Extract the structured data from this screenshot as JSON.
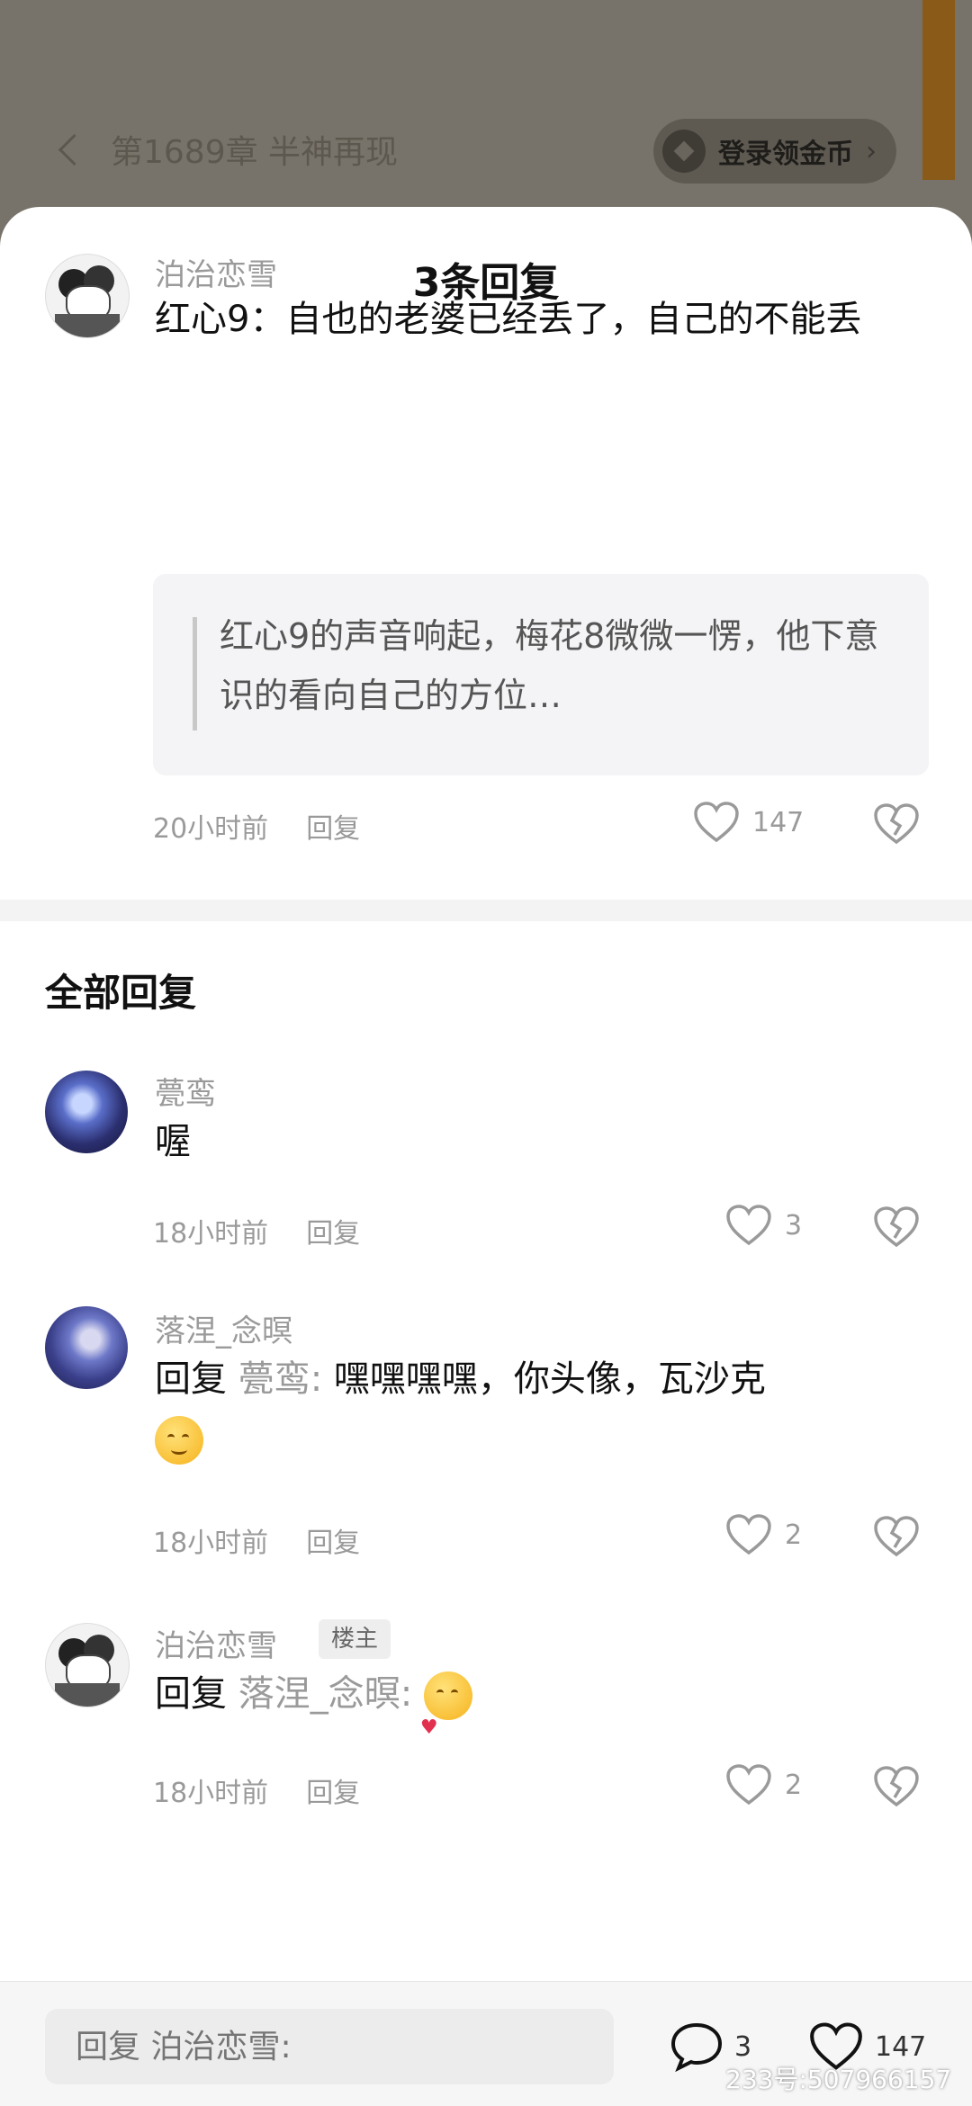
{
  "reader": {
    "chapter_title": "第1689章 半神再现",
    "coin_label": "登录领金币",
    "coin_arrow": "›"
  },
  "sheet": {
    "title": "3条回复"
  },
  "main_comment": {
    "username": "泊治恋雪",
    "text": "红心9：自也的老婆已经丢了，自己的不能丢",
    "quote": "红心9的声音响起，梅花8微微一愣，他下意识的看向自己的方位…",
    "time": "20小时前",
    "reply_label": "回复",
    "likes": "147"
  },
  "section": {
    "all_replies": "全部回复"
  },
  "replies": [
    {
      "username": "甍鸾",
      "text": "喔",
      "time": "18小时前",
      "reply_label": "回复",
      "likes": "3"
    },
    {
      "username": "落涅_念暝",
      "reply_prefix": "回复",
      "reply_to": "甍鸾:",
      "text": "嘿嘿嘿嘿，你头像，瓦沙克",
      "time": "18小时前",
      "reply_label": "回复",
      "likes": "2"
    },
    {
      "username": "泊治恋雪",
      "badge": "楼主",
      "reply_prefix": "回复",
      "reply_to": "落涅_念暝:",
      "time": "18小时前",
      "reply_label": "回复",
      "likes": "2"
    }
  ],
  "bottom_bar": {
    "input_placeholder": "回复 泊治恋雪:",
    "comment_count": "3",
    "like_count": "147"
  },
  "watermark": "233号:507966157",
  "colors": {
    "muted_text": "#9a9a9a",
    "quote_bg": "#f4f4f6",
    "bookmark": "#8a5a18"
  }
}
